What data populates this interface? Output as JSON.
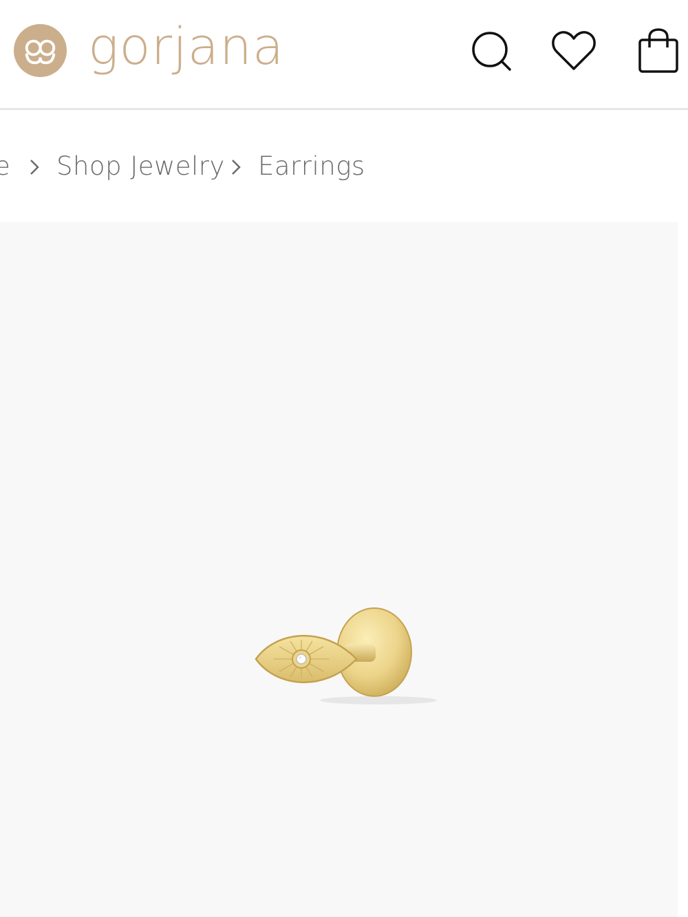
{
  "header": {
    "brand": "gorjana",
    "logo_mark": "gg-monogram",
    "brand_color": "#cbae8b",
    "icons": [
      "search-icon",
      "heart-icon",
      "shopping-bag-icon"
    ]
  },
  "breadcrumb": {
    "items": [
      "e",
      "Shop Jewelry",
      "Earrings"
    ],
    "separator_icon": "chevron-right-icon"
  },
  "gallery": {
    "image": "evil-eye-flat-back-stud-gold",
    "background": "#f8f8f8"
  }
}
